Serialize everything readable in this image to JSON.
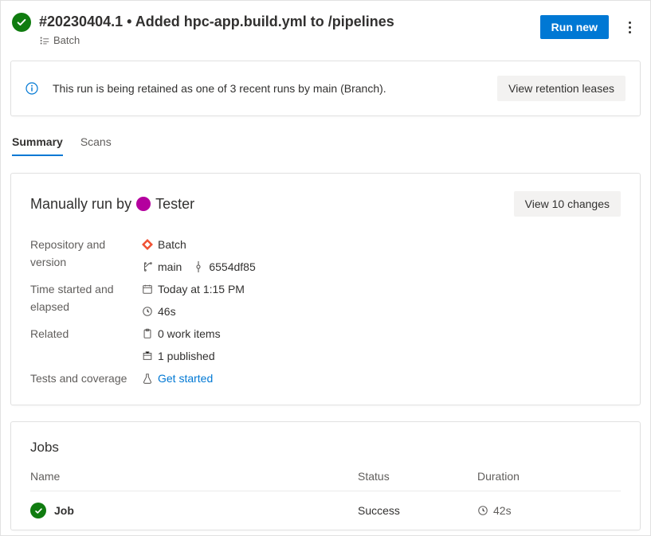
{
  "header": {
    "title": "#20230404.1 • Added hpc-app.build.yml to /pipelines",
    "subtitle": "Batch",
    "run_new": "Run new"
  },
  "banner": {
    "text": "This run is being retained as one of 3 recent runs by main (Branch).",
    "button": "View retention leases"
  },
  "tabs": {
    "summary": "Summary",
    "scans": "Scans"
  },
  "runinfo": {
    "prefix": "Manually run by",
    "user": "Tester",
    "changes_button": "View 10 changes",
    "labels": {
      "repo": "Repository and version",
      "time": "Time started and elapsed",
      "related": "Related",
      "tests": "Tests and coverage"
    },
    "repo_name": "Batch",
    "branch": "main",
    "commit": "6554df85",
    "started": "Today at 1:15 PM",
    "elapsed": "46s",
    "work_items": "0 work items",
    "published": "1 published",
    "get_started": "Get started"
  },
  "jobs": {
    "title": "Jobs",
    "cols": {
      "name": "Name",
      "status": "Status",
      "duration": "Duration"
    },
    "row": {
      "name": "Job",
      "status": "Success",
      "duration": "42s"
    }
  }
}
